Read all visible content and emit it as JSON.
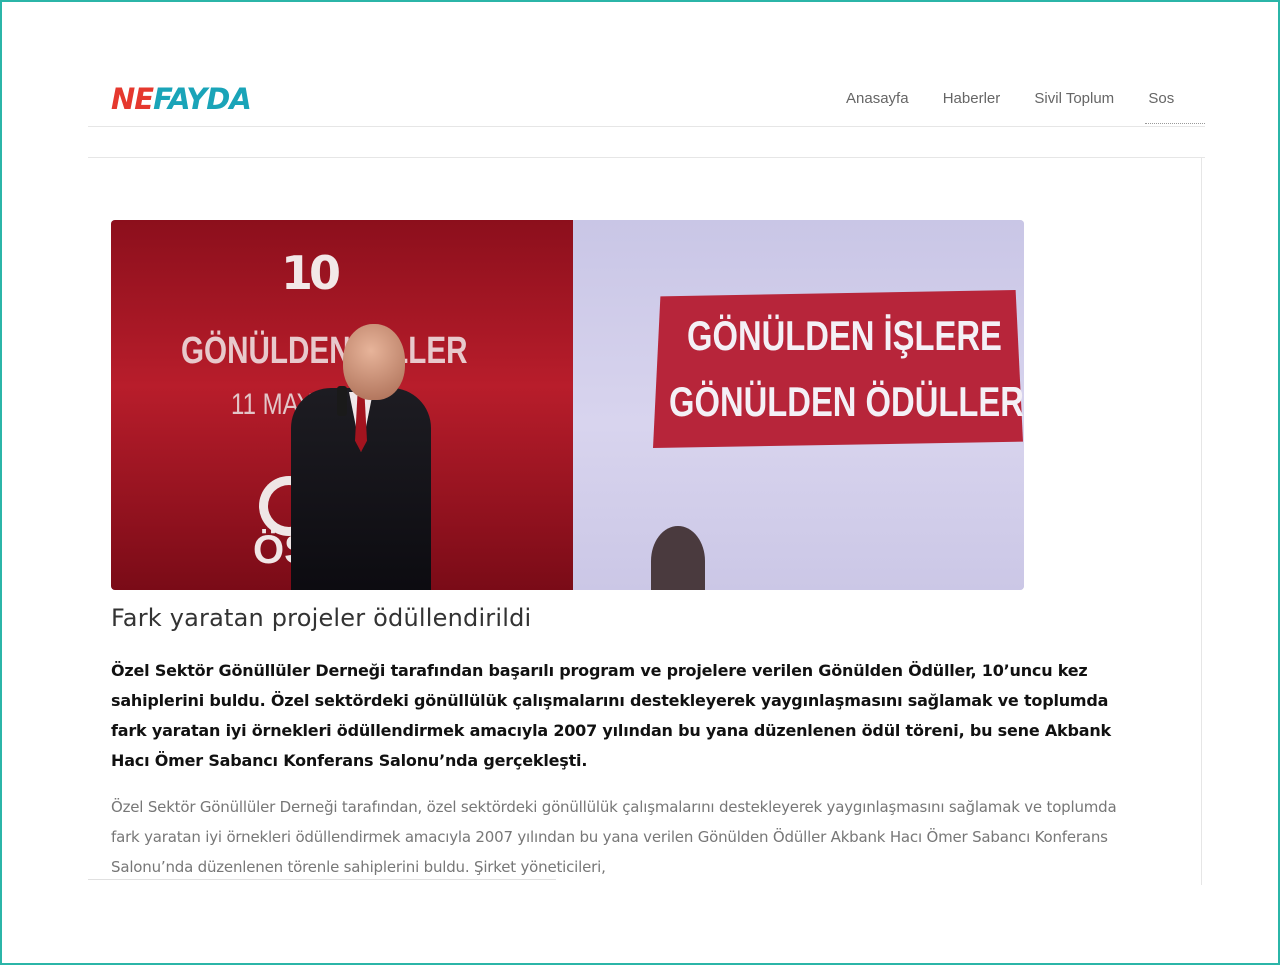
{
  "brand": {
    "logo_part1": "NE",
    "logo_part2": "FAYDA",
    "colors": {
      "accent_red": "#e5382e",
      "accent_teal": "#1aa4b8",
      "frame": "#2bb5a8"
    }
  },
  "nav": {
    "items": [
      "Anasayfa",
      "Haberler",
      "Sivil Toplum",
      "Sos"
    ]
  },
  "hero_image": {
    "text_ten": "10",
    "left_banner_title": "GÖNÜLDEN Ö  LLER",
    "left_banner_date": "11 MAYIS",
    "left_logo_text": "ÖSG",
    "right_banner_line1": "GÖNÜLDEN İŞLERE",
    "right_banner_line2": "GÖNÜLDEN ÖDÜLLER"
  },
  "article": {
    "title": "Fark yaratan projeler ödüllendirildi",
    "lead": "Özel Sektör Gönüllüler Derneği tarafından başarılı program ve projelere verilen Gönülden Ödüller, 10’uncu kez sahiplerini buldu. Özel sektördeki gönüllülük çalışmalarını destekleyerek yaygınlaşmasını sağlamak ve toplumda fark yaratan iyi örnekleri ödüllendirmek amacıyla 2007 yılından bu yana düzenlenen ödül töreni, bu sene Akbank Hacı Ömer Sabancı Konferans Salonu’nda gerçekleşti.",
    "body": "Özel Sektör Gönüllüler Derneği tarafından, özel sektördeki gönüllülük çalışmalarını destekleyerek yaygınlaşmasını sağlamak ve toplumda fark yaratan iyi örnekleri ödüllendirmek amacıyla 2007 yılından bu yana verilen Gönülden Ödüller Akbank Hacı Ömer Sabancı Konferans Salonu’nda düzenlenen törenle sahiplerini buldu. Şirket yöneticileri,"
  }
}
